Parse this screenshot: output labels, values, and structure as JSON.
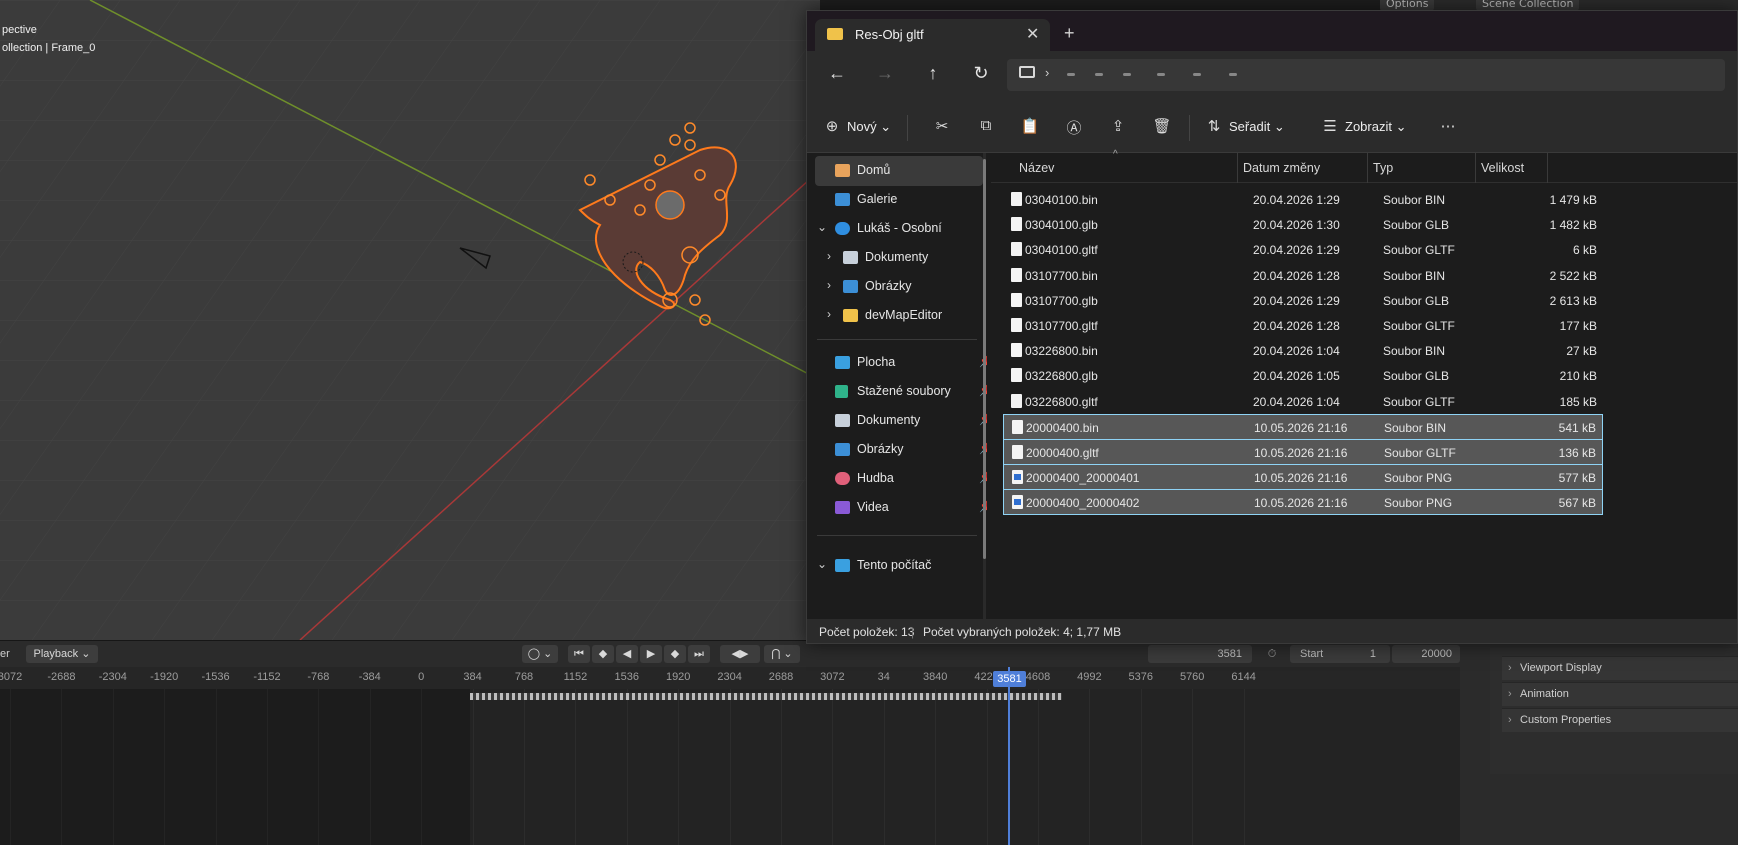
{
  "viewport": {
    "view_label": "pective",
    "collection_label": "ollection | Frame_0"
  },
  "blender_top": {
    "options_label": "Options",
    "scene_collection_label": "Scene Collection"
  },
  "properties": {
    "rows": [
      "Viewport Display",
      "Animation",
      "Custom Properties"
    ]
  },
  "timeline": {
    "editor_label": "er",
    "playback_label": "Playback",
    "current_frame": "3581",
    "start_label": "Start",
    "start_value": "1",
    "end_value": "20000",
    "ticks": [
      "3072",
      "-2688",
      "-2304",
      "-1920",
      "-1536",
      "-1152",
      "-768",
      "-384",
      "0",
      "384",
      "768",
      "1152",
      "1536",
      "1920",
      "2304",
      "2688",
      "3072",
      "34",
      "3840",
      "4224",
      "4608",
      "4992",
      "5376",
      "5760",
      "6144"
    ],
    "playhead_label": "3581"
  },
  "explorer": {
    "tab_title": "Res-Obj gltf",
    "toolbar": {
      "new_label": "Nový",
      "sort_label": "Seřadit",
      "view_label": "Zobrazit"
    },
    "nav_pane": {
      "home": "Domů",
      "gallery": "Galerie",
      "onedrive": "Lukáš - Osobní",
      "od_documents": "Dokumenty",
      "od_pictures": "Obrázky",
      "od_devmap": "devMapEditor",
      "desktop": "Plocha",
      "downloads": "Stažené soubory",
      "documents": "Dokumenty",
      "pictures": "Obrázky",
      "music": "Hudba",
      "videos": "Videa",
      "this_pc": "Tento počítač"
    },
    "columns": {
      "name": "Název",
      "date": "Datum změny",
      "type": "Typ",
      "size": "Velikost"
    },
    "files": [
      {
        "name": "03040100.bin",
        "date": "20.04.2026 1:29",
        "type": "Soubor BIN",
        "size": "1 479 kB"
      },
      {
        "name": "03040100.glb",
        "date": "20.04.2026 1:30",
        "type": "Soubor GLB",
        "size": "1 482 kB"
      },
      {
        "name": "03040100.gltf",
        "date": "20.04.2026 1:29",
        "type": "Soubor GLTF",
        "size": "6 kB"
      },
      {
        "name": "03107700.bin",
        "date": "20.04.2026 1:28",
        "type": "Soubor BIN",
        "size": "2 522 kB"
      },
      {
        "name": "03107700.glb",
        "date": "20.04.2026 1:29",
        "type": "Soubor GLB",
        "size": "2 613 kB"
      },
      {
        "name": "03107700.gltf",
        "date": "20.04.2026 1:28",
        "type": "Soubor GLTF",
        "size": "177 kB"
      },
      {
        "name": "03226800.bin",
        "date": "20.04.2026 1:04",
        "type": "Soubor BIN",
        "size": "27 kB"
      },
      {
        "name": "03226800.glb",
        "date": "20.04.2026 1:05",
        "type": "Soubor GLB",
        "size": "210 kB"
      },
      {
        "name": "03226800.gltf",
        "date": "20.04.2026 1:04",
        "type": "Soubor GLTF",
        "size": "185 kB"
      },
      {
        "name": "20000400.bin",
        "date": "10.05.2026 21:16",
        "type": "Soubor BIN",
        "size": "541 kB"
      },
      {
        "name": "20000400.gltf",
        "date": "10.05.2026 21:16",
        "type": "Soubor GLTF",
        "size": "136 kB"
      },
      {
        "name": "20000400_20000401",
        "date": "10.05.2026 21:16",
        "type": "Soubor PNG",
        "size": "577 kB"
      },
      {
        "name": "20000400_20000402",
        "date": "10.05.2026 21:16",
        "type": "Soubor PNG",
        "size": "567 kB"
      }
    ],
    "status": {
      "count": "Počet položek: 13",
      "selected": "Počet vybraných položek: 4; 1,77 MB"
    }
  }
}
